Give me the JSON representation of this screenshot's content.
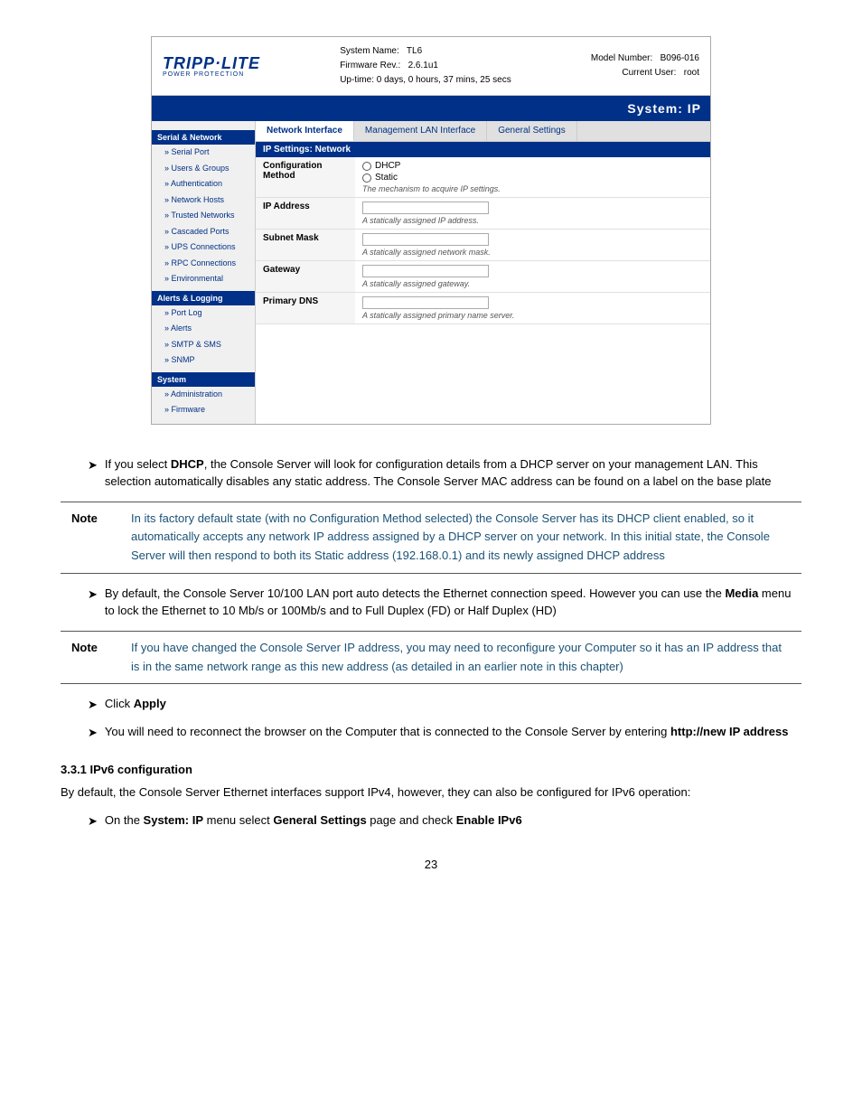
{
  "header": {
    "system_name_label": "System Name:",
    "system_name_value": "TL6",
    "firmware_label": "Firmware Rev.:",
    "firmware_value": "2.6.1u1",
    "model_label": "Model Number:",
    "model_value": "B096-016",
    "user_label": "Current User:",
    "user_value": "root",
    "uptime": "Up-time: 0 days, 0 hours, 37 mins, 25 secs",
    "logo_main": "TRIPP·LITE",
    "logo_sub": "POWER PROTECTION"
  },
  "title_bar": "System: IP",
  "tabs": [
    {
      "label": "Network Interface",
      "active": true
    },
    {
      "label": "Management LAN Interface",
      "active": false
    },
    {
      "label": "General Settings",
      "active": false
    }
  ],
  "sidebar": {
    "sections": [
      {
        "title": "Serial & Network",
        "items": [
          "Serial Port",
          "Users & Groups",
          "Authentication",
          "Network Hosts",
          "Trusted Networks",
          "Cascaded Ports",
          "UPS Connections",
          "RPC Connections",
          "Environmental"
        ]
      },
      {
        "title": "Alerts & Logging",
        "items": [
          "Port Log",
          "Alerts",
          "SMTP & SMS",
          "SNMP"
        ]
      },
      {
        "title": "System",
        "items": [
          "Administration",
          "Firmware"
        ]
      }
    ]
  },
  "ip_settings": {
    "section_title": "IP Settings: Network",
    "rows": [
      {
        "label": "Configuration Method",
        "type": "radio",
        "options": [
          "DHCP",
          "Static"
        ],
        "hint": "The mechanism to acquire IP settings."
      },
      {
        "label": "IP Address",
        "type": "input",
        "hint": "A statically assigned IP address."
      },
      {
        "label": "Subnet Mask",
        "type": "input",
        "hint": "A statically assigned network mask."
      },
      {
        "label": "Gateway",
        "type": "input",
        "hint": "A statically assigned gateway."
      },
      {
        "label": "Primary DNS",
        "type": "input",
        "hint": "A statically assigned primary name server."
      }
    ]
  },
  "doc": {
    "bullet1": {
      "arrow": "➤",
      "text_before": "If you select ",
      "bold": "DHCP",
      "text_after": ", the Console Server will look for configuration details from a DHCP server on your management LAN. This selection automatically disables any static address. The Console Server MAC address can be found on a label on the base plate"
    },
    "note1": {
      "label": "Note",
      "text": "In its factory default state (with no Configuration Method selected) the Console Server has its DHCP client enabled, so it automatically accepts any network IP address assigned by a DHCP server on your network. In this initial state, the Console Server will then respond to both its Static address (192.168.0.1) and its newly assigned DHCP address"
    },
    "bullet2": {
      "arrow": "➤",
      "text_before": "By default, the Console Server 10/100 LAN port auto detects the Ethernet connection speed. However you can use the ",
      "bold": "Media",
      "text_after": " menu to lock the Ethernet to 10 Mb/s or 100Mb/s and to Full Duplex (FD) or Half Duplex (HD)"
    },
    "note2": {
      "label": "Note",
      "text": "If you have changed the Console Server IP address, you may need to reconfigure your Computer so it has an IP address that is in the same network range as this new address (as detailed in an earlier note in this chapter)"
    },
    "bullet3": {
      "arrow": "➤",
      "text_before": "Click ",
      "bold": "Apply"
    },
    "bullet4": {
      "arrow": "➤",
      "text_before": "You will need to reconnect the browser on the Computer that is connected to the Console Server by entering ",
      "bold": "http://new IP address"
    },
    "section_heading": "3.3.1 IPv6 configuration",
    "section_desc": "By default, the Console Server Ethernet interfaces support IPv4, however, they can also be configured for IPv6 operation:",
    "bullet5": {
      "arrow": "➤",
      "text_before": "On the ",
      "bold1": "System: IP",
      "text_mid": " menu select ",
      "bold2": "General Settings",
      "text_after": " page and check ",
      "bold3": "Enable IPv6"
    },
    "page_number": "23"
  }
}
